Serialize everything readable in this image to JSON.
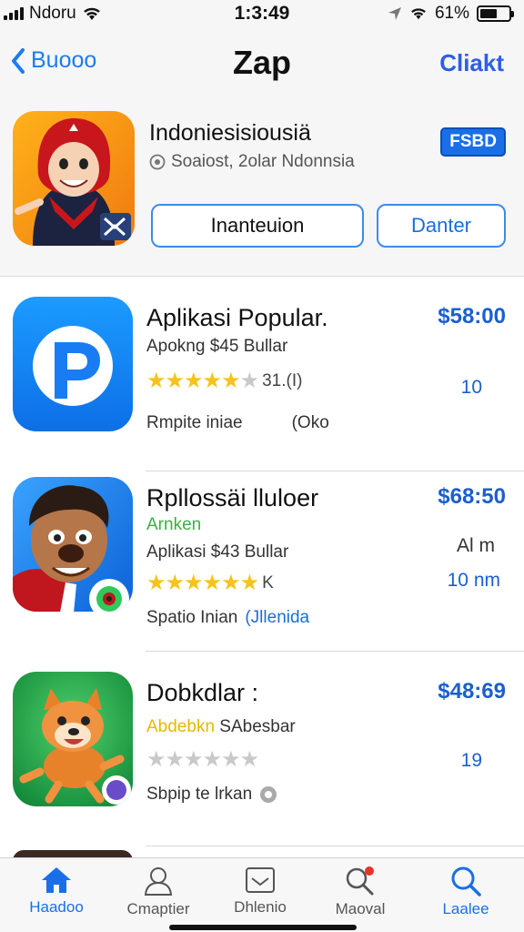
{
  "status": {
    "carrier": "Ndoru",
    "time": "1:3:49",
    "battery": "61%",
    "battery_level": 0.61
  },
  "nav": {
    "back_label": "Buooo",
    "title": "Zap",
    "right_label": "Cliakt"
  },
  "featured": {
    "name": "Indoniesisiousiä",
    "subtitle": "Soaiost, 2olar Ndonnsia",
    "badge": "FSBD",
    "button_primary": "Inanteuion",
    "button_secondary": "Danter"
  },
  "apps": [
    {
      "name": "Aplikasi Popular.",
      "tag": "",
      "desc": "Apokng $45 Bullar",
      "rating": 4.5,
      "rating_count": "31.(I)",
      "footer_left": "Rmpite iniae",
      "footer_right": "(Oko",
      "price": "$58:00",
      "size": "10",
      "meta": "",
      "icon": "p-logo-icon",
      "tag_color": "#3cb043"
    },
    {
      "name": "Rpllossäi lluloer",
      "tag": "Arnken",
      "desc": "Aplikasi $43 Bullar",
      "rating": 5,
      "rating_count": "K",
      "footer_left": "Spatio Inian",
      "footer_right": "(Jllenida",
      "price": "$68:50",
      "size": "10 nm",
      "meta": "Al m",
      "icon": "cartoon-man-icon",
      "tag_color": "#3cb043"
    },
    {
      "name": "Dobkdlar :",
      "tag": "Abdebkn",
      "tag2": "SAbesbar",
      "desc": "",
      "rating": 0,
      "rating_count": "",
      "footer_left": "Sbpip te lrkan",
      "footer_right": "",
      "price": "$48:69",
      "size": "19",
      "meta": "",
      "icon": "dog-mascot-icon",
      "tag_color": "#e6b800"
    }
  ],
  "tabs": [
    {
      "label": "Haadoo",
      "icon": "home-icon",
      "active": true
    },
    {
      "label": "Cmaptier",
      "icon": "person-icon",
      "active": false
    },
    {
      "label": "Dhlenio",
      "icon": "mail-icon",
      "active": false
    },
    {
      "label": "Maoval",
      "icon": "search-badge-icon",
      "active": false
    },
    {
      "label": "Laalee",
      "icon": "search-icon",
      "active": true
    }
  ]
}
